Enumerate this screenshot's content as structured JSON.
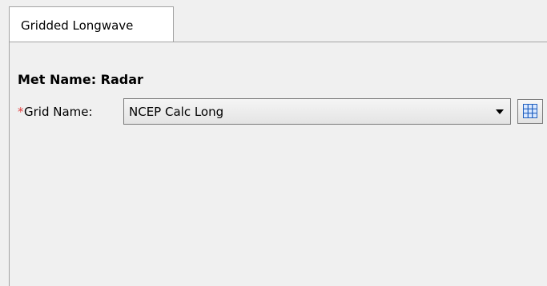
{
  "tabs": [
    {
      "label": "Gridded Longwave",
      "active": true
    }
  ],
  "form": {
    "met_name_text": "Met Name: Radar",
    "grid_required_marker": "*",
    "grid_label": "Grid Name:",
    "grid_value": "NCEP Calc Long"
  },
  "icons": {
    "dropdown": "chevron-down-icon",
    "grid_browse": "grid-table-icon"
  },
  "colors": {
    "required_marker": "#e04040",
    "grid_icon": "#1f5fbf"
  }
}
